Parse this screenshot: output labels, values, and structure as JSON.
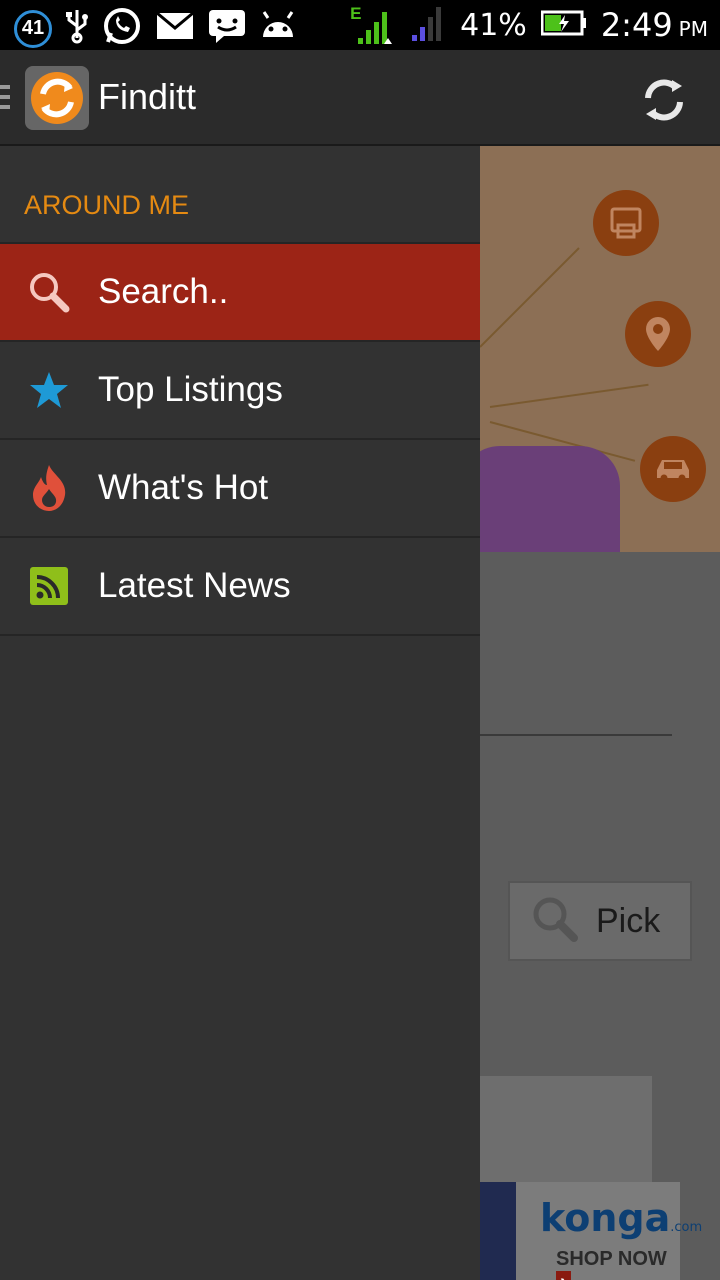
{
  "status_bar": {
    "notification_count": "41",
    "network_type": "E",
    "battery_percent": "41%",
    "time": "2:49",
    "ampm": "PM",
    "icons": [
      "usb-icon",
      "whatsapp-icon",
      "mail-icon",
      "chat-icon",
      "android-icon",
      "signal-icon",
      "signal-secondary-icon",
      "battery-charging-icon"
    ]
  },
  "app_bar": {
    "title": "Finditt",
    "icons": [
      "drawer-handle-icon",
      "app-logo-icon",
      "refresh-icon"
    ]
  },
  "drawer": {
    "section_header": "AROUND ME",
    "items": [
      {
        "label": "Search..",
        "icon": "search-icon",
        "icon_color": "#f5c8c0",
        "active": true
      },
      {
        "label": "Top Listings",
        "icon": "star-icon",
        "icon_color": "#1e9ad6",
        "active": false
      },
      {
        "label": "What's Hot",
        "icon": "flame-icon",
        "icon_color": "#e0503a",
        "active": false
      },
      {
        "label": "Latest News",
        "icon": "rss-icon",
        "icon_color": "#8fbf1a",
        "active": false
      }
    ]
  },
  "background": {
    "pick_button_label": "Pick",
    "ad_brand": "konga",
    "ad_brand_suffix": ".com",
    "ad_cta": "SHOP NOW",
    "banner_icons": [
      "atm-icon",
      "location-pin-icon",
      "car-icon"
    ]
  },
  "colors": {
    "accent_orange": "#e58a12",
    "active_item": "#9c2416",
    "drawer_bg": "#323232",
    "app_bar_bg": "#2b2b2b"
  }
}
